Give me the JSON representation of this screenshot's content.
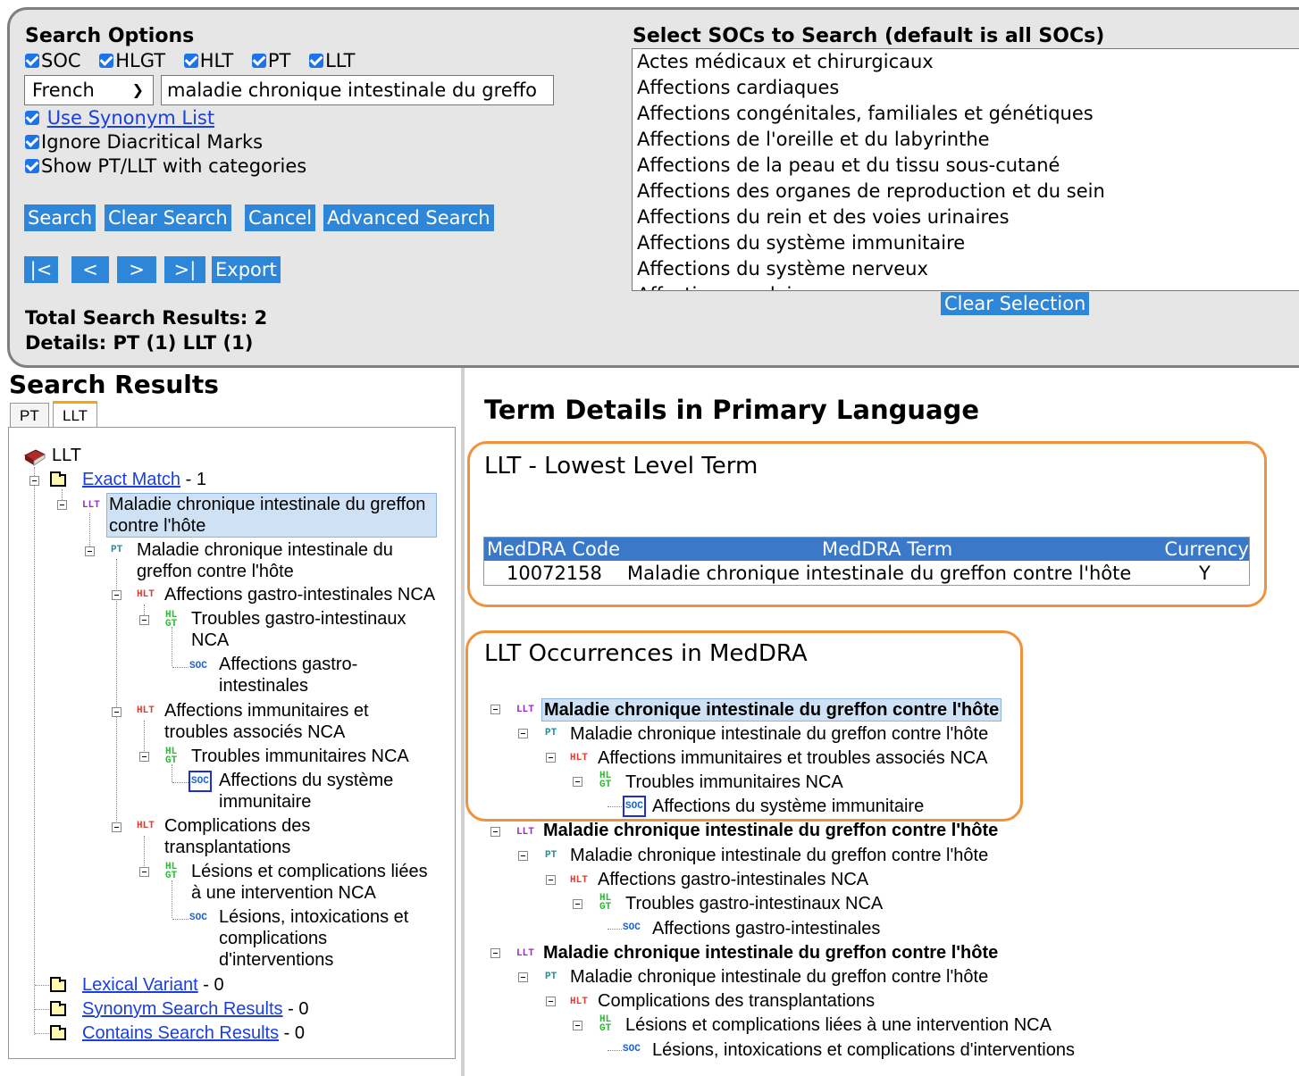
{
  "search_options": {
    "title": "Search Options",
    "levels": [
      "SOC",
      "HLGT",
      "HLT",
      "PT",
      "LLT"
    ],
    "language": "French",
    "query": "maladie chronique intestinale du greffo",
    "use_synonym_list": "Use Synonym List",
    "ignore_diacritical": "Ignore Diacritical Marks",
    "show_ptllt": "Show PT/LLT with categories",
    "buttons": {
      "search": "Search",
      "clear_search": "Clear Search",
      "cancel": "Cancel",
      "advanced": "Advanced Search"
    },
    "nav": {
      "first": "|<",
      "prev": "<",
      "next": ">",
      "last": ">|",
      "export": "Export"
    },
    "total_results": "Total Search Results: 2",
    "details": "Details: PT (1) LLT (1)"
  },
  "soc_select": {
    "title": "Select SOCs to Search (default is all SOCs)",
    "items": [
      "Actes médicaux et chirurgicaux",
      "Affections cardiaques",
      "Affections congénitales, familiales et génétiques",
      "Affections de l'oreille et du labyrinthe",
      "Affections de la peau et du tissu sous-cutané",
      "Affections des organes de reproduction et du sein",
      "Affections du rein et des voies urinaires",
      "Affections du système immunitaire",
      "Affections du système nerveux",
      "Affections oculaires"
    ],
    "clear_selection": "Clear Selection"
  },
  "results": {
    "title": "Search Results",
    "tabs": [
      "PT",
      "LLT"
    ],
    "root": "LLT",
    "exact_match": "Exact Match",
    "exact_count": "- 1",
    "llt_term": "Maladie chronique intestinale du greffon contre l'hôte",
    "pt_term": "Maladie chronique intestinale du greffon contre l'hôte",
    "hlt1": "Affections gastro-intestinales NCA",
    "hlgt1": "Troubles gastro-intestinaux NCA",
    "soc1": "Affections gastro-intestinales",
    "hlt2": "Affections immunitaires et troubles associés NCA",
    "hlgt2": "Troubles immunitaires NCA",
    "soc2": "Affections du système immunitaire",
    "hlt3": "Complications des transplantations",
    "hlgt3": "Lésions et complications liées à une intervention NCA",
    "soc3": "Lésions, intoxications et complications d'interventions",
    "lexical": "Lexical Variant",
    "lexical_count": "- 0",
    "synonym": "Synonym Search Results",
    "synonym_count": "- 0",
    "contains": "Contains Search Results",
    "contains_count": "- 0"
  },
  "details": {
    "title": "Term Details in Primary Language",
    "llt_section": "LLT - Lowest Level Term",
    "table_headers": {
      "code": "MedDRA Code",
      "term": "MedDRA Term",
      "currency": "Currency"
    },
    "table_row": {
      "code": "10072158",
      "term": "Maladie chronique intestinale du greffon contre l'hôte",
      "currency": "Y"
    },
    "occ_section": "LLT Occurrences in MedDRA"
  },
  "tags": {
    "llt": "LLT",
    "pt": "PT",
    "hlt": "HLT",
    "hl": "HL",
    "gt": "GT",
    "soc": "SOC"
  },
  "colors": {
    "button_bg": "#2e86d8",
    "link": "#1a3ee0",
    "orange_box": "#f0913c",
    "table_header": "#3a78c9",
    "panel_bg": "#e6e6e6"
  }
}
